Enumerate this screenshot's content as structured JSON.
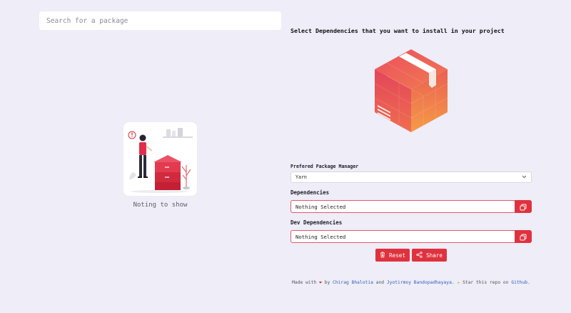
{
  "search": {
    "placeholder": "Search for a package"
  },
  "empty_state": {
    "text": "Noting to show"
  },
  "panel": {
    "heading": "Select Dependencies that you want to install in your project",
    "package_manager": {
      "label": "Prefered Package Manager",
      "value": "Yarn"
    },
    "dependencies": {
      "label": "Dependencies",
      "value": "Nothing Selected"
    },
    "dev_dependencies": {
      "label": "Dev Dependencies",
      "value": "Nothing Selected"
    },
    "buttons": {
      "reset": "Reset",
      "share": "Share"
    }
  },
  "footer": {
    "made_with": "Made with",
    "by": "by",
    "author1": "Chirag Bhalotia",
    "and": "and",
    "author2": "Jyotirmoy Bandopadhayaya.",
    "star_text": "Star this repo on",
    "github": "Github",
    "period": "."
  },
  "colors": {
    "background": "#eeedf8",
    "accent": "#e0323e",
    "link": "#2e5fb8"
  },
  "icons": [
    "cube-logo-icon",
    "chevron-down-icon",
    "copy-icon",
    "trash-icon",
    "share-icon",
    "heart-icon",
    "star-icon"
  ]
}
